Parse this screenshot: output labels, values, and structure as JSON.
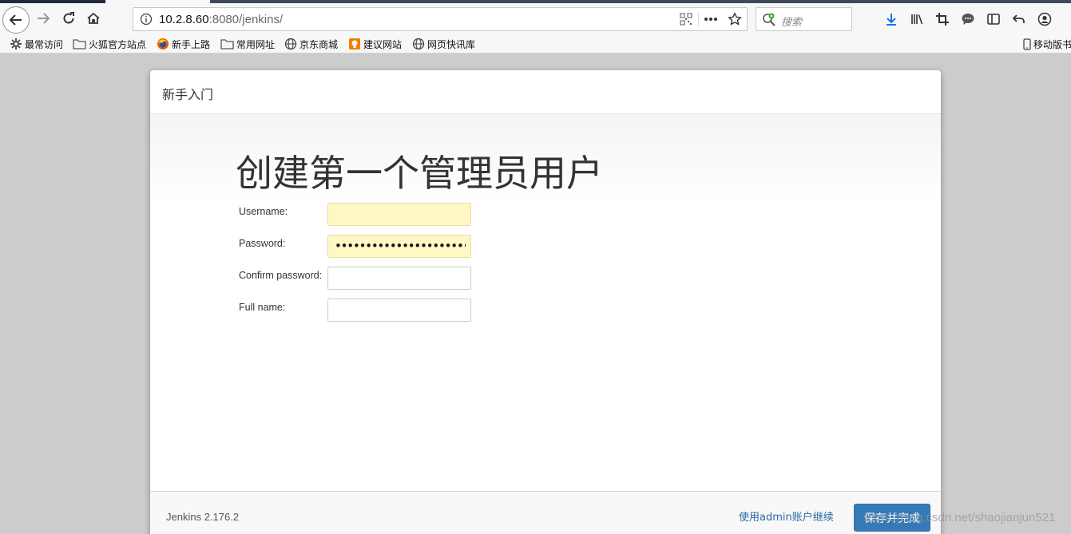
{
  "browser": {
    "url_host": "10.2.8.60",
    "url_rest": ":8080/jenkins/",
    "search_placeholder": "搜索"
  },
  "bookmarks": [
    {
      "label": "最常访问",
      "icon": "gear-icon"
    },
    {
      "label": "火狐官方站点",
      "icon": "folder-icon"
    },
    {
      "label": "新手上路",
      "icon": "firefox-icon"
    },
    {
      "label": "常用网址",
      "icon": "folder-icon"
    },
    {
      "label": "京东商城",
      "icon": "globe-icon"
    },
    {
      "label": "建议网站",
      "icon": "bulb-icon"
    },
    {
      "label": "网页快讯库",
      "icon": "globe-icon"
    }
  ],
  "mobile_bookmarks": "移动版书",
  "dialog": {
    "header": "新手入门",
    "title": "创建第一个管理员用户",
    "fields": {
      "username_label": "Username:",
      "password_label": "Password:",
      "confirm_label": "Confirm password:",
      "fullname_label": "Full name:",
      "password_value": "••••••••••••••••••••••••"
    },
    "footer": {
      "version": "Jenkins 2.176.2",
      "skip_link": "使用admin账户继续",
      "save_button": "保存并完成"
    }
  },
  "watermark": "https://blog.csdn.net/shaojianjun521",
  "colors": {
    "accent": "#337ab7",
    "autofill": "#fff7c4",
    "page_bg": "#cccccc"
  }
}
